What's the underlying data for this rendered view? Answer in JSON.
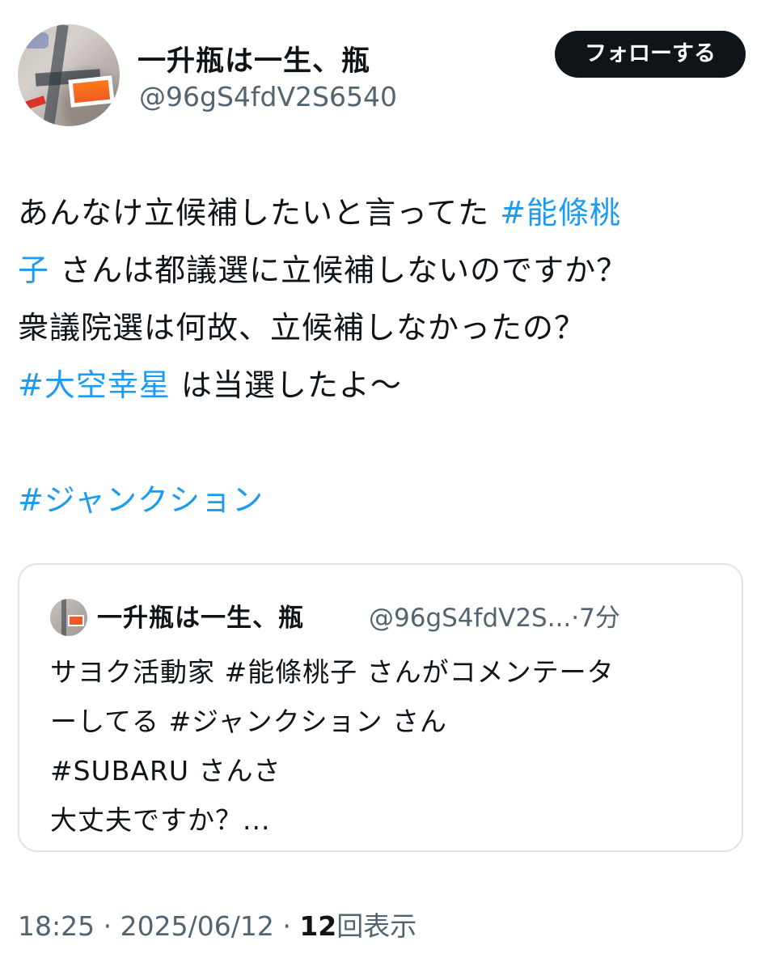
{
  "tweet": {
    "display_name": "一升瓶は一生、瓶",
    "handle": "@96gS4fdV2S6540",
    "follow_button": "フォローする",
    "lines": [
      {
        "text": "あんなけ立候補したいと言ってた ",
        "tag": "#能條桃"
      },
      {
        "tag": "子",
        "text": " さんは都議選に立候補しないのですか？"
      },
      {
        "text": "衆議院選は何故、立候補しなかったの？"
      },
      {
        "tag": "#大空幸星",
        "text": " は当選したよ〜"
      },
      {
        "tag": "#ジャンクション"
      }
    ]
  },
  "quoted": {
    "display_name": "一升瓶は一生、瓶",
    "handle_truncated": "@96gS4fdV2S...",
    "separator": "·",
    "time": "7分",
    "lines": [
      "サヨク活動家 #能條桃子 さんがコメンテータ",
      "ーしてる #ジャンクション さん",
      "#SUBARU さんさ",
      "大丈夫ですか？..."
    ]
  },
  "footer": {
    "time": "18:25",
    "separator1": "·",
    "date": "2025/06/12",
    "separator2": "·",
    "views": "12",
    "views_label": "回表示"
  }
}
